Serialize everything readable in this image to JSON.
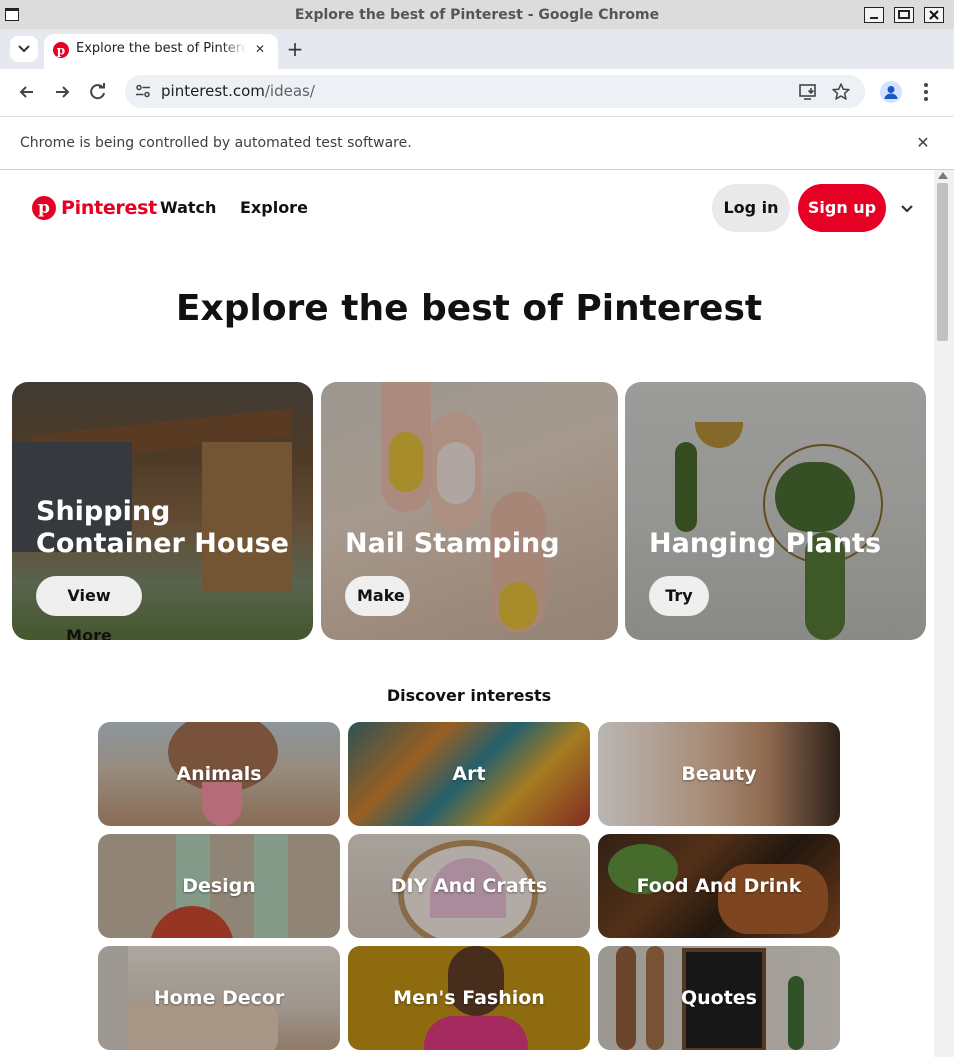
{
  "window": {
    "title": "Explore the best of Pinterest - Google Chrome"
  },
  "tab": {
    "label": "Explore the best of Pinterest",
    "favicon": "pinterest-icon"
  },
  "omnibox": {
    "host": "pinterest.com",
    "path": "/ideas/"
  },
  "infobar": {
    "message": "Chrome is being controlled by automated test software."
  },
  "header": {
    "logo_text": "Pinterest",
    "nav": [
      "Watch",
      "Explore"
    ],
    "login_label": "Log in",
    "signup_label": "Sign up"
  },
  "page": {
    "title": "Explore the best of Pinterest",
    "discover_heading": "Discover interests"
  },
  "hero_cards": [
    {
      "title_line1": "Shipping",
      "title_line2": "Container House",
      "button": "View More"
    },
    {
      "title_line1": "",
      "title_line2": "Nail Stamping",
      "button": "Make"
    },
    {
      "title_line1": "",
      "title_line2": "Hanging Plants",
      "button": "Try"
    }
  ],
  "interests": [
    "Animals",
    "Art",
    "Beauty",
    "Design",
    "DIY And Crafts",
    "Food And Drink",
    "Home Decor",
    "Men's Fashion",
    "Quotes"
  ],
  "colors": {
    "brand": "#e60023",
    "signup_bg": "#e60023",
    "login_bg": "#e9e9e9"
  }
}
